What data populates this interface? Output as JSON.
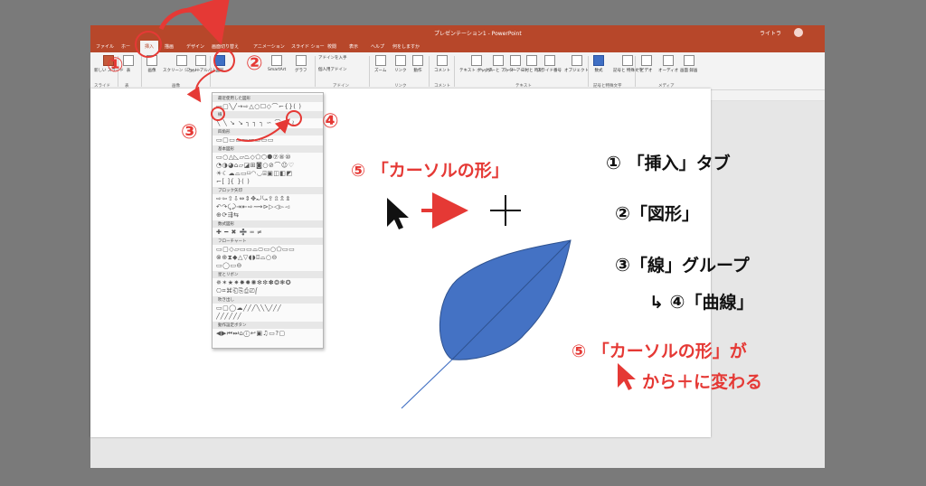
{
  "app": {
    "title": "プレゼンテーション1 - PowerPoint",
    "user": "ライトラ",
    "tabs": [
      "ファイル",
      "ホー",
      "挿入",
      "描画",
      "デザイン",
      "画面切り替え",
      "アニメーション",
      "スライド ショー",
      "校閲",
      "表示",
      "ヘルプ",
      "何をしますか"
    ],
    "active_tab": "挿入"
  },
  "ribbon": {
    "buttons": [
      {
        "label": "新しい\nスライド",
        "icon": "new-slide-icon"
      },
      {
        "label": "表",
        "icon": "table-icon"
      },
      {
        "label": "画像",
        "icon": "picture-icon"
      },
      {
        "label": "スクリーン\nショット",
        "icon": "screenshot-icon"
      },
      {
        "label": "フォト\nアルバム",
        "icon": "photo-album-icon"
      },
      {
        "label": "図形",
        "icon": "shapes-icon"
      },
      {
        "label": "SmartArt",
        "icon": "smartart-icon"
      },
      {
        "label": "グラフ",
        "icon": "chart-icon"
      },
      {
        "label": "アドインを入手",
        "icon": "addin-icon"
      },
      {
        "label": "個人用アドイン",
        "icon": "my-addins-icon"
      },
      {
        "label": "ズーム",
        "icon": "zoom-icon"
      },
      {
        "label": "リンク",
        "icon": "link-icon"
      },
      {
        "label": "動作",
        "icon": "action-icon"
      },
      {
        "label": "コメント",
        "icon": "comment-icon"
      },
      {
        "label": "テキスト\nボックス",
        "icon": "textbox-icon"
      },
      {
        "label": "ヘッダーと\nフッター",
        "icon": "header-footer-icon"
      },
      {
        "label": "ワード\nアート",
        "icon": "wordart-icon"
      },
      {
        "label": "日付と\n時刻",
        "icon": "datetime-icon"
      },
      {
        "label": "スライド番号",
        "icon": "slide-number-icon"
      },
      {
        "label": "オブジェクト",
        "icon": "object-icon"
      },
      {
        "label": "数式",
        "icon": "equation-icon"
      },
      {
        "label": "記号と\n特殊文字",
        "icon": "symbol-icon"
      },
      {
        "label": "ビデオ",
        "icon": "video-icon"
      },
      {
        "label": "オーディオ",
        "icon": "audio-icon"
      },
      {
        "label": "画面\n録画",
        "icon": "screen-record-icon"
      }
    ],
    "groups": [
      "スライド",
      "表",
      "画像",
      "アドイン",
      "リンク",
      "コメント",
      "テキスト",
      "記号と特殊文字",
      "メディア"
    ]
  },
  "shapes_menu": {
    "header": "最近使用した図形",
    "categories": [
      "線",
      "四角形",
      "基本図形",
      "ブロック矢印",
      "数式図形",
      "フローチャート",
      "星とリボン",
      "吹き出し",
      "動作設定ボタン"
    ]
  },
  "thumbnail": {
    "number": "1"
  },
  "annotations": {
    "step_markers": [
      "①",
      "②",
      "③",
      "④"
    ],
    "cursor_title": "⑤ 「カーソルの形」",
    "legend": [
      {
        "num": "①",
        "text": "「挿入」タブ"
      },
      {
        "num": "②",
        "text": "「図形」"
      },
      {
        "num": "③",
        "text": "「線」グループ"
      },
      {
        "num": "④",
        "text": "「曲線」"
      }
    ],
    "legend_arrow": "↳",
    "step5_line1": "⑤ 「カーソルの形」が",
    "step5_line2": "から＋に変わる"
  },
  "colors": {
    "accent": "#b7472a",
    "annotation": "#e53935",
    "leaf_fill": "#4472c4",
    "leaf_stroke": "#2f528f"
  }
}
